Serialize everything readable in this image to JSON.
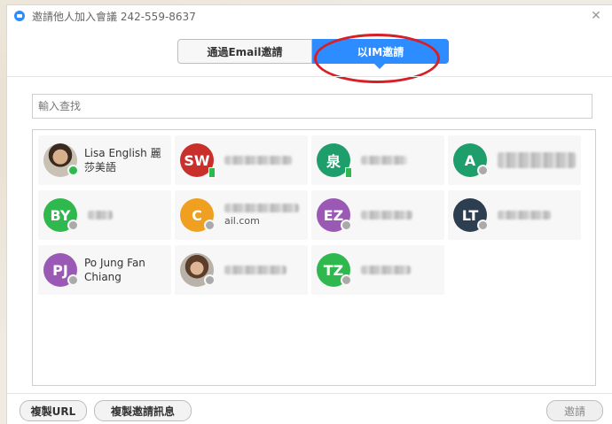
{
  "window": {
    "title": "邀請他人加入會議 242-559-8637",
    "close_symbol": "✕"
  },
  "tabs": [
    {
      "label": "通過Email邀請",
      "active": false
    },
    {
      "label": "以IM邀請",
      "active": true
    }
  ],
  "search": {
    "placeholder": "輸入查找",
    "value": ""
  },
  "contacts": [
    {
      "name": "Lisa English 麗莎美語",
      "avatar_type": "photo",
      "status": "online"
    },
    {
      "initials": "SW",
      "color": "#c9302c",
      "status": "mobile",
      "name_blurred": true
    },
    {
      "initials": "泉",
      "color": "#1e9e6a",
      "status": "mobile",
      "name_blurred": true
    },
    {
      "initials": "A",
      "color": "#1e9e6a",
      "status": "offline",
      "name_blurred": true
    },
    {
      "initials": "BY",
      "color": "#2fb84e",
      "status": "offline",
      "name_blurred": true
    },
    {
      "initials": "C",
      "color": "#f0a020",
      "status": "offline",
      "name_partial": "ail.com",
      "name_blurred": true
    },
    {
      "initials": "EZ",
      "color": "#9b59b6",
      "status": "offline",
      "name_blurred": true
    },
    {
      "initials": "LT",
      "color": "#2c3e50",
      "status": "offline",
      "name_blurred": true
    },
    {
      "initials": "PJ",
      "color": "#9b59b6",
      "status": "offline",
      "name": "Po Jung Fan Chiang"
    },
    {
      "avatar_type": "photo",
      "status": "offline",
      "name_blurred": true
    },
    {
      "initials": "TZ",
      "color": "#2fb84e",
      "status": "offline",
      "name_blurred": true
    }
  ],
  "footer": {
    "copy_url_label": "複製URL",
    "copy_invite_label": "複製邀請訊息",
    "invite_label": "邀請"
  },
  "colors": {
    "accent": "#2d8cff",
    "highlight": "#d81f26"
  }
}
